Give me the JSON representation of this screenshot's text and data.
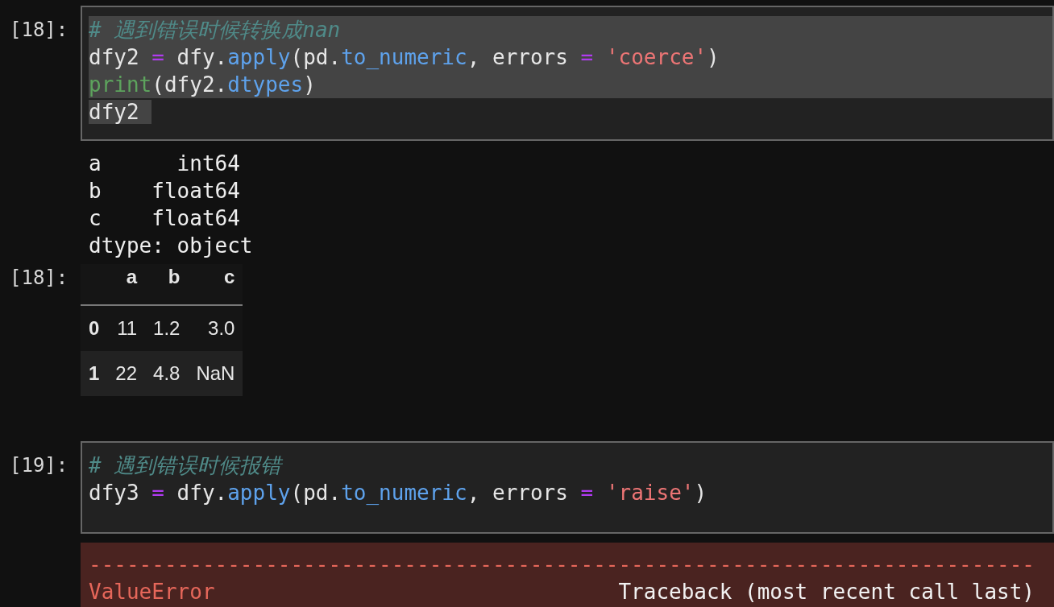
{
  "cells": [
    {
      "prompt": "[18]:",
      "lines": [
        {
          "selected": true,
          "whole_line": true,
          "tokens": [
            {
              "kind": "comment",
              "text": "# 遇到错误时候转换成nan"
            }
          ]
        },
        {
          "selected": true,
          "whole_line": true,
          "tokens": [
            {
              "kind": "plain",
              "text": "dfy2 "
            },
            {
              "kind": "op",
              "text": "="
            },
            {
              "kind": "plain",
              "text": " dfy."
            },
            {
              "kind": "func",
              "text": "apply"
            },
            {
              "kind": "plain",
              "text": "(pd."
            },
            {
              "kind": "func",
              "text": "to_numeric"
            },
            {
              "kind": "plain",
              "text": ", errors "
            },
            {
              "kind": "op",
              "text": "= "
            },
            {
              "kind": "string",
              "text": "'coerce'"
            },
            {
              "kind": "plain",
              "text": ")"
            }
          ]
        },
        {
          "selected": true,
          "whole_line": true,
          "tokens": [
            {
              "kind": "builtin",
              "text": "print"
            },
            {
              "kind": "plain",
              "text": "(dfy2."
            },
            {
              "kind": "func",
              "text": "dtypes"
            },
            {
              "kind": "plain",
              "text": ")"
            }
          ]
        },
        {
          "selected": true,
          "whole_line": false,
          "tokens": [
            {
              "kind": "plain",
              "text": "dfy2 "
            }
          ]
        }
      ],
      "stdout": [
        "a      int64",
        "b    float64",
        "c    float64",
        "dtype: object"
      ],
      "result": {
        "prompt": "[18]:",
        "columns": [
          "a",
          "b",
          "c"
        ],
        "rows": [
          {
            "index": "0",
            "cells": [
              "11",
              "1.2",
              "3.0"
            ]
          },
          {
            "index": "1",
            "cells": [
              "22",
              "4.8",
              "NaN"
            ]
          }
        ]
      }
    },
    {
      "prompt": "[19]:",
      "lines": [
        {
          "selected": false,
          "tokens": [
            {
              "kind": "comment",
              "text": "# 遇到错误时候报错"
            }
          ]
        },
        {
          "selected": false,
          "tokens": [
            {
              "kind": "plain",
              "text": "dfy3 "
            },
            {
              "kind": "op",
              "text": "="
            },
            {
              "kind": "plain",
              "text": " dfy."
            },
            {
              "kind": "func",
              "text": "apply"
            },
            {
              "kind": "plain",
              "text": "(pd."
            },
            {
              "kind": "func",
              "text": "to_numeric"
            },
            {
              "kind": "plain",
              "text": ", errors "
            },
            {
              "kind": "op",
              "text": "= "
            },
            {
              "kind": "string",
              "text": "'raise'"
            },
            {
              "kind": "plain",
              "text": ")"
            }
          ]
        }
      ],
      "error": {
        "rule": "---------------------------------------------------------------------------",
        "name": "ValueError",
        "traceback": "Traceback (most recent call last)"
      }
    }
  ]
}
